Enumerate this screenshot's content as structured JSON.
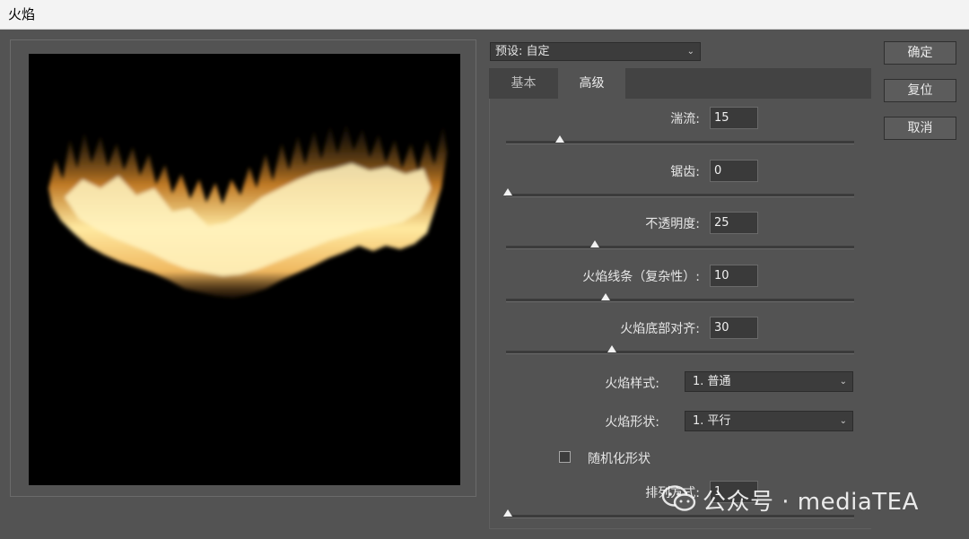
{
  "window": {
    "title": "火焰"
  },
  "preset": {
    "label": "预设: 自定"
  },
  "tabs": [
    {
      "label": "基本"
    },
    {
      "label": "高级"
    }
  ],
  "fields": {
    "turbulence": {
      "label": "湍流:",
      "value": "15",
      "slider": 0.15
    },
    "jag": {
      "label": "锯齿:",
      "value": "0",
      "slider": 0.0
    },
    "opacity": {
      "label": "不透明度:",
      "value": "25",
      "slider": 0.25
    },
    "lines": {
      "label": "火焰线条（复杂性）:",
      "value": "10",
      "slider": 0.28
    },
    "bottom_align": {
      "label": "火焰底部对齐:",
      "value": "30",
      "slider": 0.3
    },
    "arrangement": {
      "label": "排列方式:",
      "value": "1",
      "slider": 0.0
    }
  },
  "dropdowns": {
    "style": {
      "label": "火焰样式:",
      "value": "1. 普通"
    },
    "shape": {
      "label": "火焰形状:",
      "value": "1. 平行"
    }
  },
  "checkbox": {
    "label": "随机化形状",
    "checked": false
  },
  "buttons": {
    "ok": "确定",
    "reset": "复位",
    "cancel": "取消"
  },
  "watermark": {
    "text": "公众号 · mediaTEA"
  },
  "colors": {
    "background": "#535353",
    "flame_core": "#fff4b0",
    "flame_edge": "#e89a30"
  }
}
